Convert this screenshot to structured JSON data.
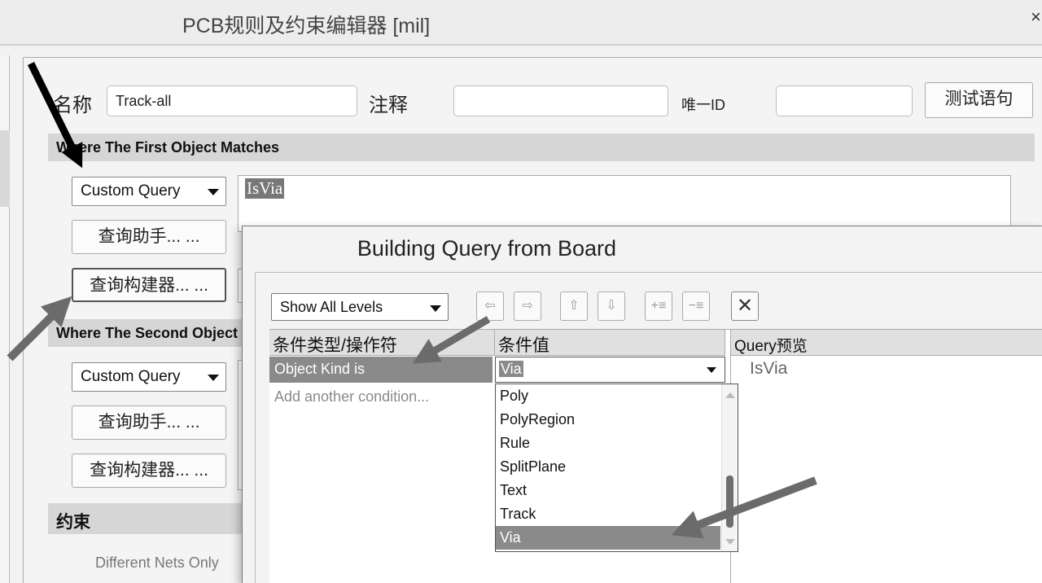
{
  "window": {
    "title": "PCB规则及约束编辑器 [mil]",
    "close_glyph": "×"
  },
  "rule": {
    "name_label": "名称",
    "name_value": "Track-all",
    "comment_label": "注释",
    "comment_value": "",
    "uid_label": "唯一ID",
    "uid_value": "",
    "test_button": "测试语句"
  },
  "first": {
    "header": "Where The First Object Matches",
    "mode": "Custom Query",
    "helper_button": "查询助手... ...",
    "builder_button": "查询构建器... ...",
    "query_text": "IsVia"
  },
  "second": {
    "header": "Where The Second Object Matches",
    "mode": "Custom Query",
    "helper_button": "查询助手... ...",
    "builder_button": "查询构建器... ..."
  },
  "constraints": {
    "header": "约束",
    "different_nets": "Different Nets Only"
  },
  "dialog": {
    "title": "Building Query from Board",
    "levels": "Show All Levels",
    "toolbar": {
      "left": "⇦",
      "right": "⇨",
      "up": "⇧",
      "down": "⇩",
      "add": "+≡",
      "remove": "−≡",
      "delete": "✕"
    },
    "col_condition": "条件类型/操作符",
    "col_value": "条件值",
    "col_preview": "Query预览",
    "row_condition": "Object Kind is",
    "row_value": "Via",
    "add_condition": "Add another condition...",
    "preview_text": "IsVia",
    "dropdown_options": [
      "Poly",
      "PolyRegion",
      "Rule",
      "SplitPlane",
      "Text",
      "Track",
      "Via"
    ],
    "dropdown_selected": "Via"
  },
  "colors": {
    "selection": "#8a8a8a",
    "section_bg": "#d6d6d6",
    "arrow_black": "#000000",
    "arrow_gray": "#6b6b6b"
  }
}
